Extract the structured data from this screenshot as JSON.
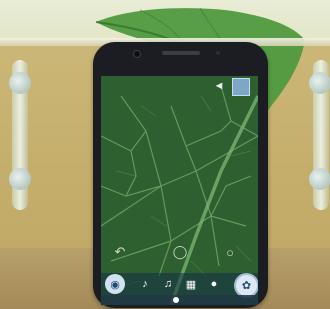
{
  "scene": {
    "description_colors": {
      "background": "#cbb777",
      "leaf": "#3f8a3a",
      "phone_body": "#1b1d22",
      "screen_leaf": "#2f6231",
      "toolbar_accent": "#d2e2f1"
    }
  },
  "phone_screen": {
    "top_right_icons": [
      "speaker-icon",
      "thumbnail-icon"
    ],
    "mid_row_icons": [
      "flip-icon",
      "focus-icon",
      "zoom-icon"
    ],
    "toolbar_icons": [
      "camera-icon",
      "mic-icon",
      "music-icon",
      "gallery-icon",
      "light-icon",
      "shutter-icon"
    ],
    "caption_left": "",
    "caption_right": ""
  }
}
